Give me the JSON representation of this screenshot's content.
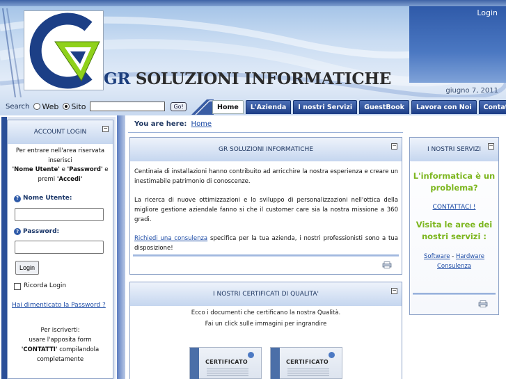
{
  "header": {
    "login_link": "Login",
    "site_title_prefix": "GR",
    "site_title_rest": " SOLUZIONI INFORMATICHE",
    "date": "giugno 7, 2011",
    "logo_icon": "gr-logo-icon"
  },
  "search": {
    "label": "Search",
    "options": [
      "Web",
      "Sito"
    ],
    "selected": "Sito",
    "value": "",
    "go_label": "Go!"
  },
  "nav": {
    "tabs": [
      "Home",
      "L'Azienda",
      "I nostri Servizi",
      "GuestBook",
      "Lavora con Noi",
      "Contatti"
    ],
    "active": "Home"
  },
  "login_panel": {
    "title": "ACCOUNT LOGIN",
    "intro_1": "Per entrare nell'area riservata inserisci",
    "intro_user": "'Nome Utente'",
    "intro_and": " e ",
    "intro_pass": "'Password'",
    "intro_e": " e",
    "intro_premi": "premi ",
    "intro_accedi": "'Accedi'",
    "username_label": "Nome Utente:",
    "password_label": "Password:",
    "username_value": "",
    "password_value": "",
    "login_button": "Login",
    "remember_label": "Ricorda Login",
    "forgot_link": "Hai dimenticato la Password ?",
    "register_1": "Per iscriverti:",
    "register_2": "usare l'apposita form",
    "register_3_bold": "'CONTATTI'",
    "register_3_rest": " compilandola",
    "register_4": "completamente"
  },
  "breadcrumb": {
    "label": "You are here:",
    "link": "Home"
  },
  "main_panel": {
    "title": "GR SOLUZIONI INFORMATICHE",
    "para_1": "Centinaia di installazioni hanno contribuito ad arricchire la nostra esperienza e creare un inestimabile patrimonio di conoscenze.",
    "para_2": "La ricerca di nuove ottimizzazioni e lo sviluppo di personalizzazioni nell'ottica della migliore gestione aziendale fanno si che il customer care sia la nostra missione a 360 gradi.",
    "para_3_link": "Richiedi una consulenza",
    "para_3_rest": " specifica per la tua azienda, i nostri professionisti sono a tua disposizione!"
  },
  "cert_panel": {
    "title": "I NOSTRI CERTIFICATI DI QUALITA'",
    "line_1": "Ecco i documenti che certificano la nostra Qualità.",
    "line_2": "Fai un click sulle immagini per ingrandire",
    "cert_label": "CERTIFICATO"
  },
  "services_panel": {
    "title": "I NOSTRI SERVIZI",
    "headline": "L'informatica è un problema?",
    "contact_link": "CONTATTACI !",
    "visit": "Visita le aree dei nostri servizi :",
    "link_software": "Software",
    "sep": " - ",
    "link_hardware": "Hardware",
    "link_consulenza": "Consulenza"
  }
}
